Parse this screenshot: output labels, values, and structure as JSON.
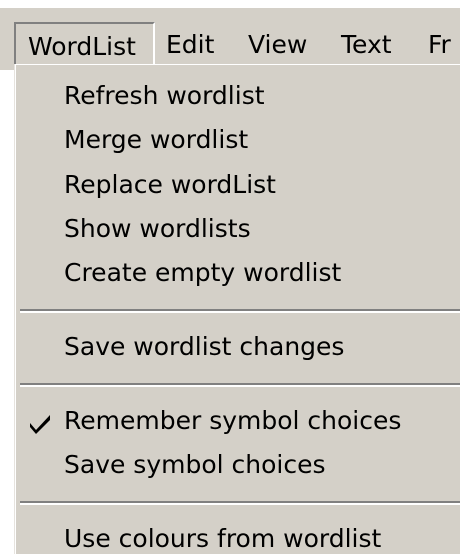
{
  "menubar": {
    "items": [
      {
        "label": "WordList"
      },
      {
        "label": "Edit"
      },
      {
        "label": "View"
      },
      {
        "label": "Text"
      },
      {
        "label": "Fr"
      }
    ]
  },
  "menu": {
    "items": [
      {
        "label": "Refresh wordlist"
      },
      {
        "label": "Merge wordlist"
      },
      {
        "label": "Replace wordList"
      },
      {
        "label": "Show wordlists"
      },
      {
        "label": "Create empty wordlist"
      },
      {
        "label": "Save wordlist changes"
      },
      {
        "label": "Remember symbol choices",
        "checked": true
      },
      {
        "label": "Save symbol choices"
      },
      {
        "label": "Use colours from wordlist"
      }
    ]
  }
}
